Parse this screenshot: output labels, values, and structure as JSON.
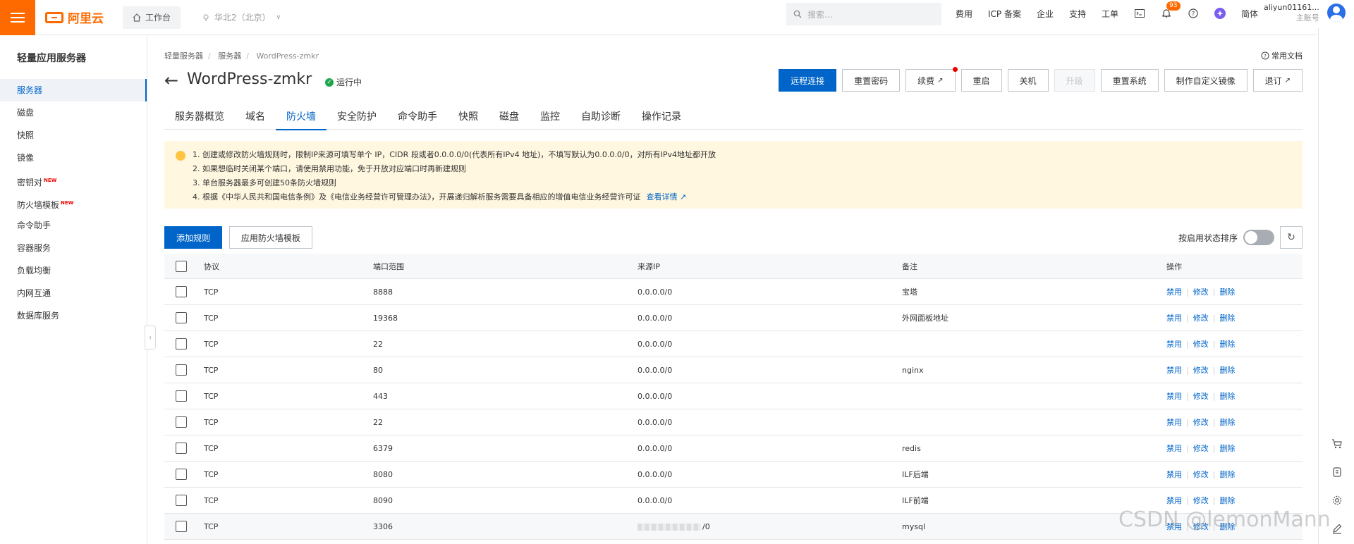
{
  "topbar": {
    "logo_text": "阿里云",
    "workbench": "工作台",
    "region": "华北2（北京）",
    "search_placeholder": "搜索...",
    "links": [
      "费用",
      "ICP 备案",
      "企业",
      "支持",
      "工单"
    ],
    "notification_count": "93",
    "language": "简体",
    "account_name": "aliyun01161...",
    "account_type": "主账号"
  },
  "sidebar": {
    "title": "轻量应用服务器",
    "items": [
      {
        "label": "服务器",
        "new": ""
      },
      {
        "label": "磁盘",
        "new": ""
      },
      {
        "label": "快照",
        "new": ""
      },
      {
        "label": "镜像",
        "new": ""
      },
      {
        "label": "密钥对",
        "new": "NEW"
      },
      {
        "label": "防火墙模板",
        "new": "NEW"
      },
      {
        "label": "命令助手",
        "new": ""
      },
      {
        "label": "容器服务",
        "new": ""
      },
      {
        "label": "负载均衡",
        "new": ""
      },
      {
        "label": "内网互通",
        "new": ""
      },
      {
        "label": "数据库服务",
        "new": ""
      }
    ]
  },
  "breadcrumb": [
    "轻量服务器",
    "服务器",
    "WordPress-zmkr"
  ],
  "doc_link": "常用文档",
  "header": {
    "title": "WordPress-zmkr",
    "status": "运行中",
    "buttons": {
      "remote": "远程连接",
      "reset_pwd": "重置密码",
      "renew": "续费",
      "restart": "重启",
      "shutdown": "关机",
      "upgrade": "升级",
      "reset_sys": "重置系统",
      "custom_image": "制作自定义镜像",
      "refund": "退订"
    }
  },
  "tabs": [
    "服务器概览",
    "域名",
    "防火墙",
    "安全防护",
    "命令助手",
    "快照",
    "磁盘",
    "监控",
    "自助诊断",
    "操作记录"
  ],
  "notice": {
    "lines": [
      "1. 创建或修改防火墙规则时，限制IP来源可填写单个 IP，CIDR 段或者0.0.0.0/0(代表所有IPv4 地址)，不填写默认为0.0.0.0/0，对所有IPv4地址都开放",
      "2. 如果想临时关闭某个端口，请使用禁用功能，免于开放对应端口时再新建规则",
      "3. 单台服务器最多可创建50条防火墙规则",
      "4. 根据《中华人民共和国电信条例》及《电信业务经营许可管理办法》，开展递归解析服务需要具备相应的增值电信业务经营许可证"
    ],
    "link": "查看详情"
  },
  "toolbar": {
    "add": "添加规则",
    "apply_template": "应用防火墙模板",
    "sort_label": "按启用状态排序"
  },
  "table": {
    "headers": {
      "protocol": "协议",
      "port": "端口范围",
      "ip": "来源IP",
      "note": "备注",
      "op": "操作"
    },
    "ops": {
      "disable": "禁用",
      "edit": "修改",
      "delete": "删除"
    },
    "rows": [
      {
        "protocol": "TCP",
        "port": "8888",
        "ip": "0.0.0.0/0",
        "note": "宝塔"
      },
      {
        "protocol": "TCP",
        "port": "19368",
        "ip": "0.0.0.0/0",
        "note": "外网面板地址"
      },
      {
        "protocol": "TCP",
        "port": "22",
        "ip": "0.0.0.0/0",
        "note": ""
      },
      {
        "protocol": "TCP",
        "port": "80",
        "ip": "0.0.0.0/0",
        "note": "nginx"
      },
      {
        "protocol": "TCP",
        "port": "443",
        "ip": "0.0.0.0/0",
        "note": ""
      },
      {
        "protocol": "TCP",
        "port": "22",
        "ip": "0.0.0.0/0",
        "note": ""
      },
      {
        "protocol": "TCP",
        "port": "6379",
        "ip": "0.0.0.0/0",
        "note": "redis"
      },
      {
        "protocol": "TCP",
        "port": "8080",
        "ip": "0.0.0.0/0",
        "note": "ILF后端"
      },
      {
        "protocol": "TCP",
        "port": "8090",
        "ip": "0.0.0.0/0",
        "note": "ILF前端"
      },
      {
        "protocol": "TCP",
        "port": "3306",
        "ip": "/0",
        "note": "mysql"
      }
    ]
  },
  "watermark": "CSDN @lemonMann",
  "colors": {
    "brand": "#ff6a00",
    "primary": "#0064c8",
    "notice_bg": "#fff7e0"
  }
}
